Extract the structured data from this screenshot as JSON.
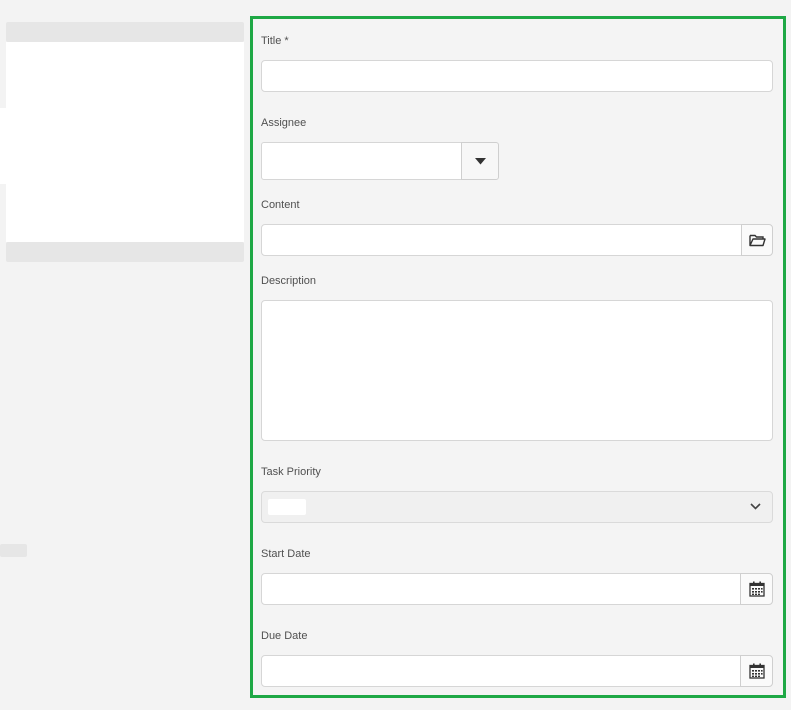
{
  "form": {
    "title": {
      "label": "Title *",
      "value": ""
    },
    "assignee": {
      "label": "Assignee",
      "value": "",
      "icon": "caret-down-icon"
    },
    "content": {
      "label": "Content",
      "value": "",
      "icon": "folder-open-icon"
    },
    "description": {
      "label": "Description",
      "value": ""
    },
    "task_priority": {
      "label": "Task Priority",
      "selected": "",
      "icon": "chevron-down-icon"
    },
    "start_date": {
      "label": "Start Date",
      "value": "",
      "icon": "calendar-icon"
    },
    "due_date": {
      "label": "Due Date",
      "value": "",
      "icon": "calendar-icon"
    }
  },
  "colors": {
    "highlight_border": "#1ea845",
    "page_background": "#f3f3f3",
    "input_background": "#ffffff"
  }
}
